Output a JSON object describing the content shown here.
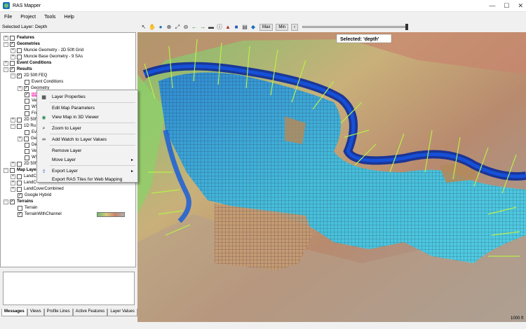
{
  "window": {
    "title": "RAS Mapper"
  },
  "menu": [
    "File",
    "Project",
    "Tools",
    "Help"
  ],
  "selected_layer_text": "Selected Layer: Depth",
  "toolbar": {
    "max_label": "Max",
    "min_label": "Min",
    "step_label": "‹"
  },
  "map": {
    "selected_label": "Selected: 'depth'",
    "scale_text": "1000 ft"
  },
  "tree": {
    "features": "Features",
    "geometries": "Geometries",
    "geom1": "Muncie Geometry - 2D 50ft Grid",
    "geom2": "Muncie Base Geometry - 9 SAs",
    "event_conditions": "Event Conditions",
    "results": "Results",
    "plan1": "2D 50ft FEQ",
    "plan1_event": "Event Conditions",
    "plan1_geometry": "Geometry",
    "plan1_depth": "Depth (Max)",
    "partial_vel1": "Vel",
    "partial_ws1": "WS",
    "partial_fro": "Fro",
    "plan2": "2D 50ft",
    "plan3": "1D Ru",
    "partial_evt": "Eve",
    "partial_geo": "Geo",
    "partial_dep": "Dep",
    "partial_vel2": "Vel",
    "partial_ws2": "WS",
    "plan4": "2D 50ft",
    "map_layers": "Map Layers",
    "landcover1": "LandC",
    "landcover2": "LandC",
    "landcover_combined": "LandCoverCombined",
    "google_hybrid": "Google Hybrid",
    "terrains": "Terrains",
    "terrain": "Terrain",
    "terrain_channel": "TerrainWithChannel"
  },
  "context_menu": {
    "layer_properties": "Layer Properties",
    "edit_map_params": "Edit Map Parameters",
    "view_3d": "View Map in 3D Viewer",
    "zoom_layer": "Zoom to Layer",
    "add_watch": "Add Watch to Layer Values",
    "remove_layer": "Remove Layer",
    "move_layer": "Move Layer",
    "export_layer": "Export Layer",
    "export_tiles": "Export RAS Tiles for Web Mapping"
  },
  "tabs": [
    "Messages",
    "Views",
    "Profile Lines",
    "Active Features",
    "Layer Values"
  ],
  "colors": {
    "water_deep": "#08208a",
    "water_mid": "#1a5fd8",
    "water_shallow": "#5be0ff",
    "terrain_low": "#6fb86f",
    "terrain_high": "#c8826a",
    "highlight": "#ff66cc"
  }
}
